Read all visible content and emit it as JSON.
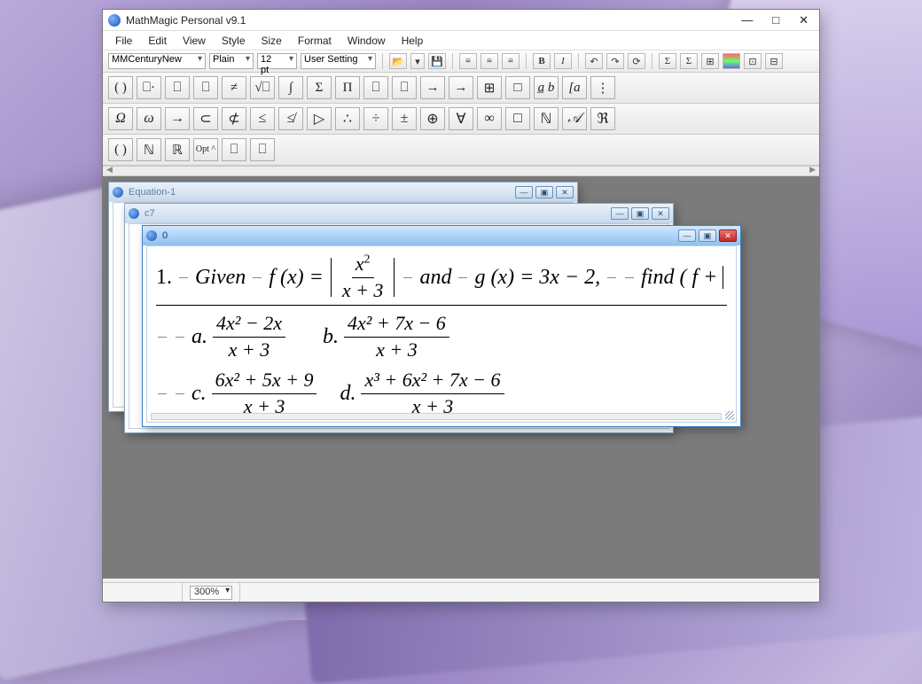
{
  "window": {
    "title": "MathMagic Personal v9.1",
    "controls": {
      "min": "—",
      "max": "□",
      "close": "✕"
    }
  },
  "menu": [
    "File",
    "Edit",
    "View",
    "Style",
    "Size",
    "Format",
    "Window",
    "Help"
  ],
  "toolbar": {
    "font": "MMCenturyNew",
    "style": "Plain",
    "size": "12 pt",
    "preset": "User Setting",
    "bold": "B",
    "italic": "I"
  },
  "palettes": {
    "templates": [
      "( )",
      "⎕·",
      "⎕",
      "⎕",
      "≠",
      "√⎕",
      "∫",
      "Σ",
      "Π",
      "⎕",
      "⎕",
      "→",
      "→",
      "⊞",
      "□",
      "a̲ b",
      "[a",
      "⋮"
    ],
    "symbols": [
      "Ω",
      "ω",
      "→",
      "⊂",
      "⊄",
      "≤",
      "≰",
      "▷",
      "∴",
      "÷",
      "±",
      "⊕",
      "∀",
      "∞",
      "□",
      "ℕ",
      "𝒜",
      "ℜ"
    ],
    "extras": [
      "( )",
      "ℕ",
      "ℝ",
      "Opt ^",
      "⎕",
      "⎕"
    ]
  },
  "status": {
    "zoom": "300%"
  },
  "mdi": {
    "eq1": {
      "title": "Equation-1"
    },
    "c7": {
      "title": "c7"
    },
    "zero": {
      "title": "0",
      "line1_prefix": "1.",
      "line1_given": "Given",
      "line1_fx": "f (x)  =",
      "frac1_num": "x",
      "frac1_num_sup": "2",
      "frac1_den": "x + 3",
      "line1_and": "and",
      "line1_gx": "g (x)  =  3x − 2,",
      "line1_find": "find  ( f +",
      "a_label": "a.",
      "a_num": "4x² − 2x",
      "a_den": "x + 3",
      "b_label": "b.",
      "b_num": "4x² + 7x − 6",
      "b_den": "x + 3",
      "c_label": "c.",
      "c_num": "6x² + 5x + 9",
      "c_den": "x + 3",
      "d_label": "d.",
      "d_num": "x³ + 6x² + 7x − 6",
      "d_den": "x + 3"
    }
  }
}
